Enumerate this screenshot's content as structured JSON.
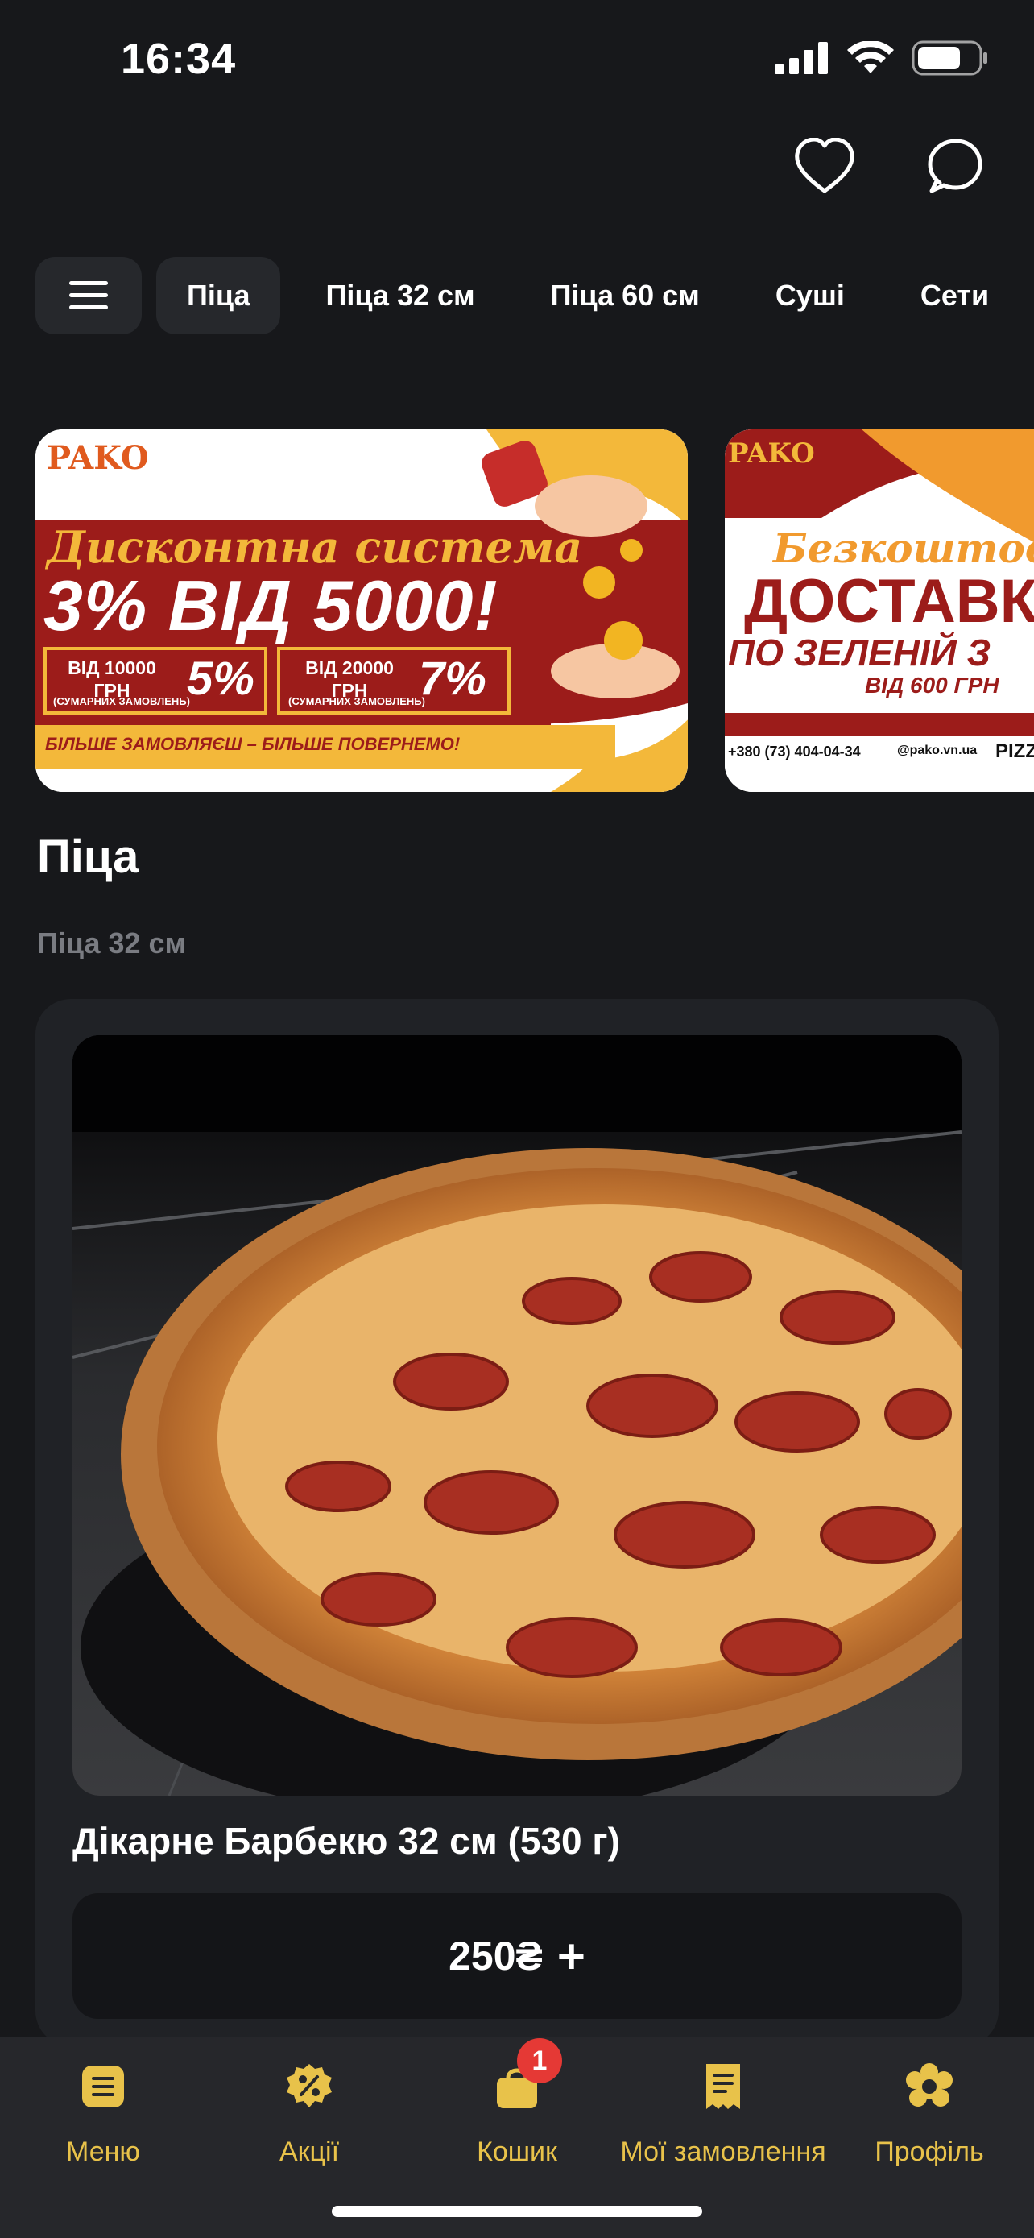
{
  "status": {
    "time": "16:34",
    "battery_level": 0.7
  },
  "header": {
    "favorites_icon": "heart-icon",
    "chat_icon": "chat-bubble-icon"
  },
  "categories": [
    {
      "label": "Піца",
      "active": true
    },
    {
      "label": "Піца 32 см",
      "active": false
    },
    {
      "label": "Піца 60 см",
      "active": false
    },
    {
      "label": "Суші",
      "active": false
    },
    {
      "label": "Сети",
      "active": false
    }
  ],
  "banners": {
    "first": {
      "logo": "PAKO",
      "line1": "Дисконтна система",
      "line2": "3% ВІД 5000!",
      "tier1_amount": "ВІД 10000 ГРН",
      "tier1_note": "(СУМАРНИХ ЗАМОВЛЕНЬ)",
      "tier1_percent": "5%",
      "tier2_amount": "ВІД 20000 ГРН",
      "tier2_note": "(СУМАРНИХ ЗАМОВЛЕНЬ)",
      "tier2_percent": "7%",
      "slogan": "БІЛЬШЕ ЗАМОВЛЯЄШ – БІЛЬШЕ ПОВЕРНЕМО!"
    },
    "second": {
      "logo": "PAKO",
      "line1": "Безкоштовн",
      "line2": "ДОСТАВК",
      "line3": "ПО ЗЕЛЕНІЙ З",
      "line4": "ВІД 600 ГРН",
      "phone": "+380 (73) 404-04-34",
      "instagram": "@pako.vn.ua",
      "tail": "PIZZ"
    }
  },
  "section": {
    "title": "Піца",
    "subtitle": "Піца 32 см"
  },
  "product": {
    "name": "Дікарне Барбекю  32 см (530 г)",
    "price": "250₴",
    "add_symbol": "+"
  },
  "tabbar": {
    "accent": "#e8c24a",
    "items": [
      {
        "label": "Меню",
        "icon": "menu-list-icon"
      },
      {
        "label": "Акції",
        "icon": "discount-icon"
      },
      {
        "label": "Кошик",
        "icon": "cart-bag-icon",
        "badge": "1"
      },
      {
        "label": "Мої замовлення",
        "icon": "receipt-icon"
      },
      {
        "label": "Профіль",
        "icon": "profile-icon"
      }
    ]
  }
}
